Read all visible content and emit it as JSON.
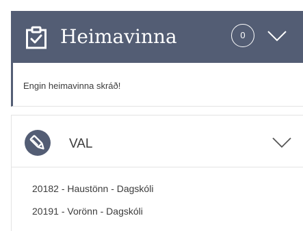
{
  "homework": {
    "title": "Heimavinna",
    "count": "0",
    "empty_message": "Engin heimavinna skráð!",
    "icon": "clipboard-check-icon",
    "header_color": "#535d74"
  },
  "val": {
    "title": "VAL",
    "icon": "pencil-icon",
    "items": [
      {
        "label": "20182 - Haustönn - Dagskóli"
      },
      {
        "label": "20191 - Vorönn - Dagskóli"
      }
    ]
  }
}
